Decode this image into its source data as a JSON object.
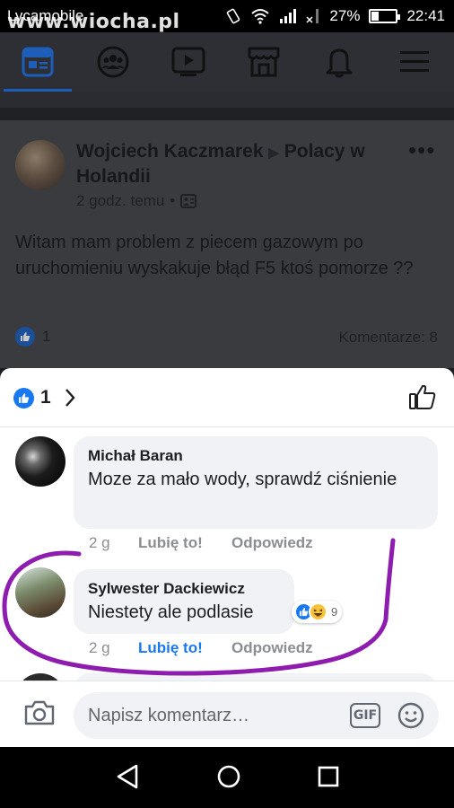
{
  "status_bar": {
    "carrier": "Lycamobile",
    "watermark": "www.wiocha.pl",
    "battery_percent_label": "27%",
    "battery_level": 0.27,
    "time": "22:41"
  },
  "fb_nav": {
    "items": [
      "news-feed",
      "groups",
      "watch",
      "marketplace",
      "notifications",
      "menu"
    ],
    "active": "news-feed"
  },
  "post": {
    "author": "Wojciech Kaczmarek",
    "separator": "▶",
    "group": "Polacy w Holandii",
    "time": "2 godz. temu",
    "text": "Witam mam problem z piecem gazowym  po uruchomieniu wyskakuje błąd F5  ktoś pomorze  ??",
    "likes": "1",
    "comments": "Komentarze: 8"
  },
  "comments_sheet": {
    "like_count": "1",
    "comments": [
      {
        "author": "Michał Baran",
        "text": "Moze za mało wody, sprawdź ciśnienie",
        "time": "2 g",
        "like_label": "Lubię to!",
        "reply_label": "Odpowiedz",
        "liked": false
      },
      {
        "author": "Sylwester Dackiewicz",
        "text": "Niestety ale podlasie",
        "time": "2 g",
        "like_label": "Lubię to!",
        "reply_label": "Odpowiedz",
        "liked": true,
        "reactions": {
          "types": [
            "like",
            "haha"
          ],
          "count": "9"
        }
      }
    ],
    "composer": {
      "placeholder": "Napisz komentarz…",
      "gif_label": "GIF"
    }
  },
  "colors": {
    "accent": "#1877f2",
    "annotation": "#8e1cae"
  }
}
